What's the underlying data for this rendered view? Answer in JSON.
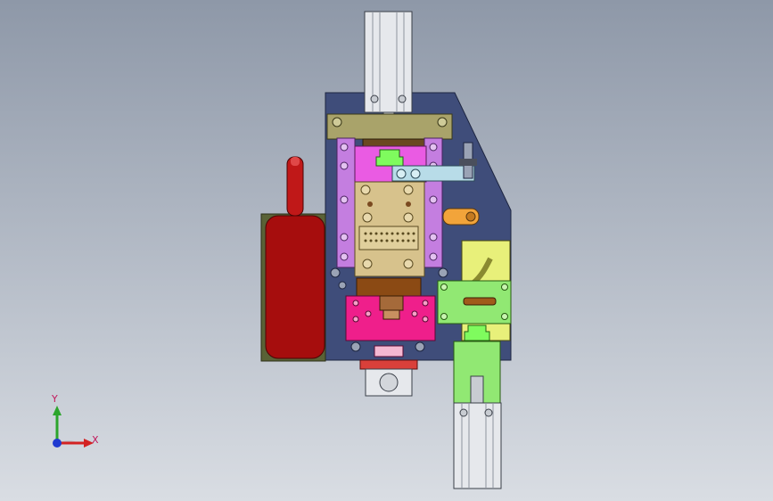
{
  "view": {
    "background_top": "#8e98a8",
    "background_bottom": "#d9dde3"
  },
  "triad": {
    "x_label": "X",
    "y_label": "Y"
  },
  "model_colors": {
    "base_plate": "#3f4d7a",
    "cylinder_body": "#e6e8ec",
    "purple_rail": "#c47ee0",
    "magenta_block": "#ea5be3",
    "green_guide": "#7ffb5e",
    "tan_block": "#d7c28c",
    "pink_block": "#ef1f8b",
    "red_handle": "#a60d0d",
    "lime_plate": "#91e873",
    "yellow_plate": "#e8f07a",
    "light_blue_arm": "#b8dce8",
    "olive_bracket": "#a9a36a",
    "orange_link": "#f2a43a",
    "brown_plate": "#8b4a14"
  },
  "icons": {
    "axis_triad": "xyz-axis-triad-icon"
  }
}
